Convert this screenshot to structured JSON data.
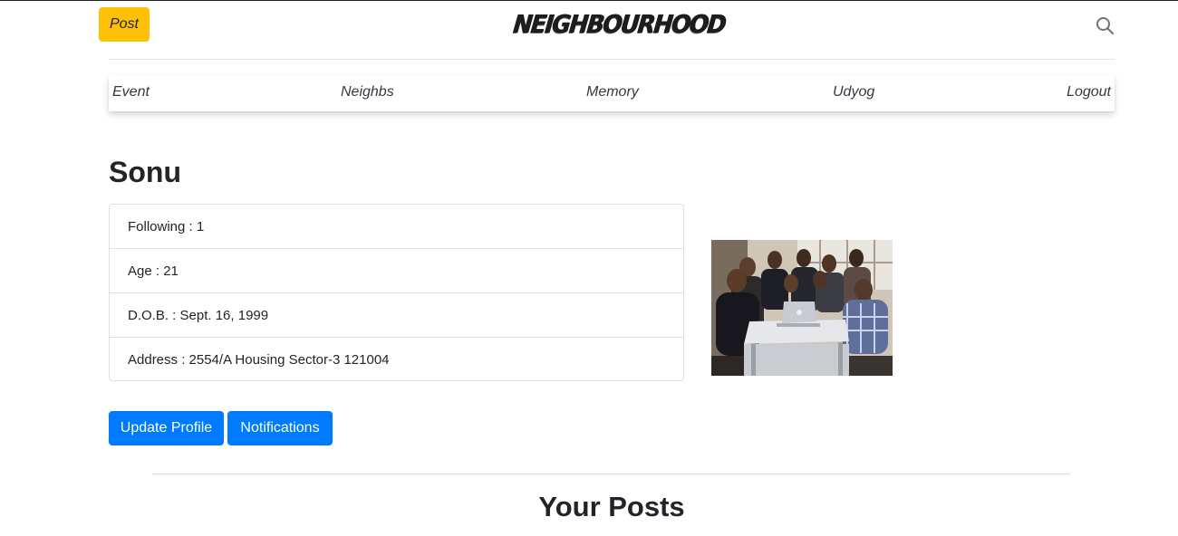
{
  "header": {
    "post_label": "Post",
    "brand": "NEIGHBOURHOOD",
    "search_icon": "search-icon"
  },
  "nav": {
    "items": [
      {
        "label": "Event"
      },
      {
        "label": "Neighbs"
      },
      {
        "label": "Memory"
      },
      {
        "label": "Udyog"
      },
      {
        "label": "Logout"
      }
    ]
  },
  "profile": {
    "name": "Sonu",
    "details": [
      {
        "text": "Following : 1"
      },
      {
        "text": "Age : 21"
      },
      {
        "text": "D.O.B. : Sept. 16, 1999"
      },
      {
        "text": "Address : 2554/A Housing Sector-3 121004"
      }
    ],
    "photo": "group-photo"
  },
  "actions": {
    "update_label": "Update Profile",
    "notifications_label": "Notifications"
  },
  "posts": {
    "title": "Your Posts"
  },
  "colors": {
    "post_button": "#ffc107",
    "primary": "#007bff"
  }
}
